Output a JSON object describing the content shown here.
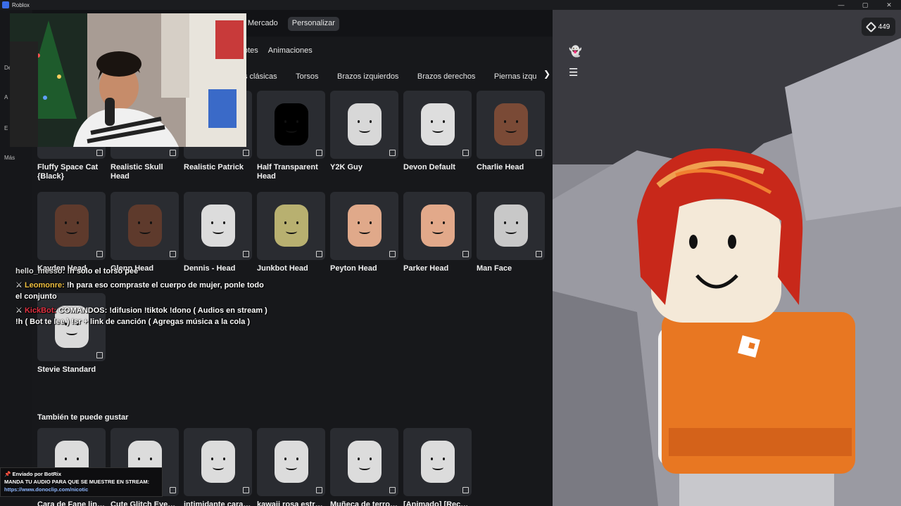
{
  "window": {
    "title": "Roblox",
    "controls": [
      "—",
      "▢",
      "✕"
    ]
  },
  "leftnav": [
    "Dest",
    "A",
    "E",
    "Más"
  ],
  "tabs": {
    "top": [
      "Mercado",
      "Personalizar"
    ],
    "active": "Personalizar"
  },
  "subtabs": [
    "otes",
    "Animaciones"
  ],
  "categories": [
    "s clásicas",
    "Torsos",
    "Brazos izquierdos",
    "Brazos derechos",
    "Piernas izqu"
  ],
  "items": [
    {
      "name": "Fluffy Space Cat {Black}",
      "skin": "#ccc"
    },
    {
      "name": "Realistic Skull Head",
      "skin": "#ccc"
    },
    {
      "name": "Realistic Patrick",
      "skin": "#ccc"
    },
    {
      "name": "Half Transparent Head",
      "skin": "#000"
    },
    {
      "name": "Y2K Guy",
      "skin": "#d8d8d8"
    },
    {
      "name": "Devon Default",
      "skin": "#dedede"
    },
    {
      "name": "Charlie Head",
      "skin": "#7a4a36"
    },
    {
      "name": "Kayden Head",
      "skin": "#5e3a2c"
    },
    {
      "name": "Glenn Head",
      "skin": "#5e3a2c"
    },
    {
      "name": "Dennis - Head",
      "skin": "#dcdcdc"
    },
    {
      "name": "Junkbot Head",
      "skin": "#b8b070"
    },
    {
      "name": "Peyton Head",
      "skin": "#e0a98a"
    },
    {
      "name": "Parker Head",
      "skin": "#e2a98a"
    },
    {
      "name": "Man Face",
      "skin": "#c8c8c8"
    },
    {
      "name": "Stevie Standard",
      "skin": "#dadada"
    }
  ],
  "recommend": {
    "title": "También te puede gustar",
    "items": [
      "Cara de Fane linda",
      "Cute Glitch Eyes [R",
      "intimidante cara de",
      "kawaii rosa estrella",
      "Muñeca de terror h",
      "[Animado] [Recolor"
    ]
  },
  "chat": [
    {
      "user": "hello_messo:",
      "text": "!h solo el torso pee",
      "color": "plain"
    },
    {
      "user": "Leomonre:",
      "text": "!h para eso compraste el cuerpo de mujer, ponle todo el conjunto",
      "color": "gold"
    },
    {
      "user": "KickBot:",
      "text": "COMANDOS: !difusion !tiktok !dono ( Audios en stream ) !h ( Bot te lee ) !sr + link de canción ( Agregas música a la cola )",
      "color": "red"
    }
  ],
  "notification": {
    "sender": "Enviado por",
    "bot": "BotRix",
    "message": "MANDA TU AUDIO PARA QUE SE MUESTRE EN STREAM:",
    "link": "https://www.donoclip.com/nicotic"
  },
  "robux": "449",
  "colors": {
    "accent": "#33353a",
    "viewport_bg": "#8d8d95",
    "shirt": "#e87722",
    "hair": "#c8281a"
  }
}
